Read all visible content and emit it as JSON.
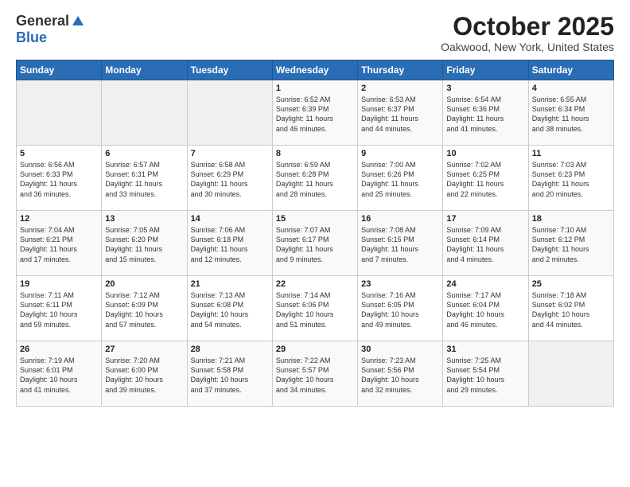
{
  "header": {
    "logo_general": "General",
    "logo_blue": "Blue",
    "month_title": "October 2025",
    "location": "Oakwood, New York, United States"
  },
  "days_of_week": [
    "Sunday",
    "Monday",
    "Tuesday",
    "Wednesday",
    "Thursday",
    "Friday",
    "Saturday"
  ],
  "weeks": [
    [
      {
        "num": "",
        "info": ""
      },
      {
        "num": "",
        "info": ""
      },
      {
        "num": "",
        "info": ""
      },
      {
        "num": "1",
        "info": "Sunrise: 6:52 AM\nSunset: 6:39 PM\nDaylight: 11 hours\nand 46 minutes."
      },
      {
        "num": "2",
        "info": "Sunrise: 6:53 AM\nSunset: 6:37 PM\nDaylight: 11 hours\nand 44 minutes."
      },
      {
        "num": "3",
        "info": "Sunrise: 6:54 AM\nSunset: 6:36 PM\nDaylight: 11 hours\nand 41 minutes."
      },
      {
        "num": "4",
        "info": "Sunrise: 6:55 AM\nSunset: 6:34 PM\nDaylight: 11 hours\nand 38 minutes."
      }
    ],
    [
      {
        "num": "5",
        "info": "Sunrise: 6:56 AM\nSunset: 6:33 PM\nDaylight: 11 hours\nand 36 minutes."
      },
      {
        "num": "6",
        "info": "Sunrise: 6:57 AM\nSunset: 6:31 PM\nDaylight: 11 hours\nand 33 minutes."
      },
      {
        "num": "7",
        "info": "Sunrise: 6:58 AM\nSunset: 6:29 PM\nDaylight: 11 hours\nand 30 minutes."
      },
      {
        "num": "8",
        "info": "Sunrise: 6:59 AM\nSunset: 6:28 PM\nDaylight: 11 hours\nand 28 minutes."
      },
      {
        "num": "9",
        "info": "Sunrise: 7:00 AM\nSunset: 6:26 PM\nDaylight: 11 hours\nand 25 minutes."
      },
      {
        "num": "10",
        "info": "Sunrise: 7:02 AM\nSunset: 6:25 PM\nDaylight: 11 hours\nand 22 minutes."
      },
      {
        "num": "11",
        "info": "Sunrise: 7:03 AM\nSunset: 6:23 PM\nDaylight: 11 hours\nand 20 minutes."
      }
    ],
    [
      {
        "num": "12",
        "info": "Sunrise: 7:04 AM\nSunset: 6:21 PM\nDaylight: 11 hours\nand 17 minutes."
      },
      {
        "num": "13",
        "info": "Sunrise: 7:05 AM\nSunset: 6:20 PM\nDaylight: 11 hours\nand 15 minutes."
      },
      {
        "num": "14",
        "info": "Sunrise: 7:06 AM\nSunset: 6:18 PM\nDaylight: 11 hours\nand 12 minutes."
      },
      {
        "num": "15",
        "info": "Sunrise: 7:07 AM\nSunset: 6:17 PM\nDaylight: 11 hours\nand 9 minutes."
      },
      {
        "num": "16",
        "info": "Sunrise: 7:08 AM\nSunset: 6:15 PM\nDaylight: 11 hours\nand 7 minutes."
      },
      {
        "num": "17",
        "info": "Sunrise: 7:09 AM\nSunset: 6:14 PM\nDaylight: 11 hours\nand 4 minutes."
      },
      {
        "num": "18",
        "info": "Sunrise: 7:10 AM\nSunset: 6:12 PM\nDaylight: 11 hours\nand 2 minutes."
      }
    ],
    [
      {
        "num": "19",
        "info": "Sunrise: 7:11 AM\nSunset: 6:11 PM\nDaylight: 10 hours\nand 59 minutes."
      },
      {
        "num": "20",
        "info": "Sunrise: 7:12 AM\nSunset: 6:09 PM\nDaylight: 10 hours\nand 57 minutes."
      },
      {
        "num": "21",
        "info": "Sunrise: 7:13 AM\nSunset: 6:08 PM\nDaylight: 10 hours\nand 54 minutes."
      },
      {
        "num": "22",
        "info": "Sunrise: 7:14 AM\nSunset: 6:06 PM\nDaylight: 10 hours\nand 51 minutes."
      },
      {
        "num": "23",
        "info": "Sunrise: 7:16 AM\nSunset: 6:05 PM\nDaylight: 10 hours\nand 49 minutes."
      },
      {
        "num": "24",
        "info": "Sunrise: 7:17 AM\nSunset: 6:04 PM\nDaylight: 10 hours\nand 46 minutes."
      },
      {
        "num": "25",
        "info": "Sunrise: 7:18 AM\nSunset: 6:02 PM\nDaylight: 10 hours\nand 44 minutes."
      }
    ],
    [
      {
        "num": "26",
        "info": "Sunrise: 7:19 AM\nSunset: 6:01 PM\nDaylight: 10 hours\nand 41 minutes."
      },
      {
        "num": "27",
        "info": "Sunrise: 7:20 AM\nSunset: 6:00 PM\nDaylight: 10 hours\nand 39 minutes."
      },
      {
        "num": "28",
        "info": "Sunrise: 7:21 AM\nSunset: 5:58 PM\nDaylight: 10 hours\nand 37 minutes."
      },
      {
        "num": "29",
        "info": "Sunrise: 7:22 AM\nSunset: 5:57 PM\nDaylight: 10 hours\nand 34 minutes."
      },
      {
        "num": "30",
        "info": "Sunrise: 7:23 AM\nSunset: 5:56 PM\nDaylight: 10 hours\nand 32 minutes."
      },
      {
        "num": "31",
        "info": "Sunrise: 7:25 AM\nSunset: 5:54 PM\nDaylight: 10 hours\nand 29 minutes."
      },
      {
        "num": "",
        "info": ""
      }
    ]
  ]
}
